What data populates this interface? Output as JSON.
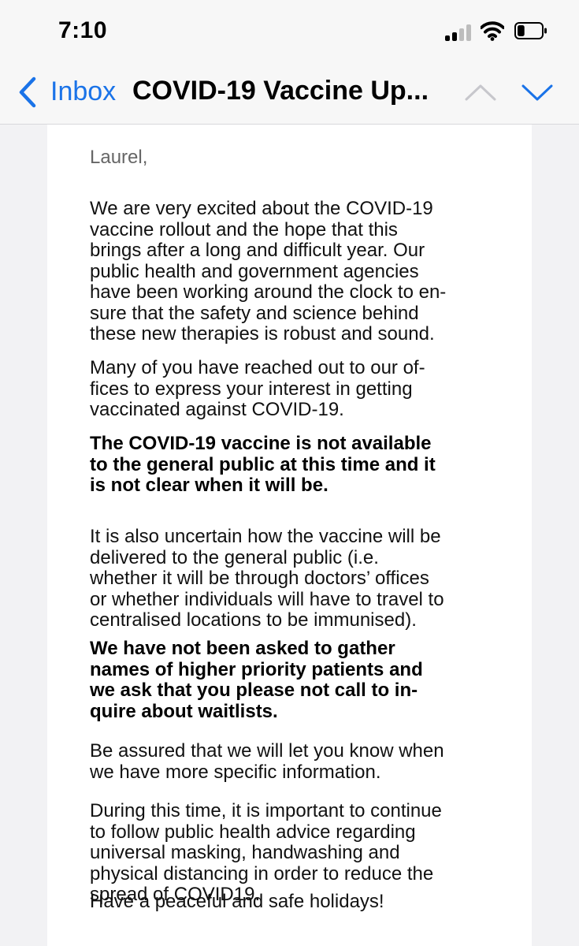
{
  "status_bar": {
    "time": "7:10",
    "signal_bars_active": 2,
    "battery_level": 0.3
  },
  "nav": {
    "back_label": "Inbox",
    "title": "COVID-19 Vaccine Up..."
  },
  "email": {
    "salutation": "Laurel,",
    "paragraphs": [
      {
        "bold": false,
        "lines": [
          "We are very excited about the COVID-19",
          "vaccine rollout and the hope that this",
          "brings after a long and difficult year.  Our",
          "public health and government agencies",
          "have been working around the clock to en-",
          "sure that the safety and science behind",
          "these new therapies is robust and sound."
        ]
      },
      {
        "bold": false,
        "lines": [
          "Many of you have reached out to our of-",
          "fices to express your interest in getting",
          "vaccinated against COVID-19."
        ]
      },
      {
        "bold": true,
        "lines": [
          "The COVID-19 vaccine is not available",
          "to the general public at this time and it",
          "is not clear when it will be."
        ]
      },
      {
        "bold": false,
        "lines": [
          "It is also uncertain how the vaccine will be",
          "delivered to the general public (i.e.",
          "whether it will be through doctors’ offices",
          "or whether individuals will have to travel to",
          "centralised locations to be immunised)."
        ]
      },
      {
        "bold": true,
        "lines": [
          "We have not been asked to gather",
          "names of higher priority patients and",
          "we ask that you please not call to in-",
          "quire about waitlists."
        ]
      },
      {
        "bold": false,
        "lines": [
          "Be assured that we will let you know when",
          "we have more specific information."
        ]
      },
      {
        "bold": false,
        "lines": [
          "During this time, it is important to continue",
          "to follow public health advice regarding",
          "universal masking, handwashing and",
          "physical distancing in order to reduce the",
          "spread of COVID19."
        ]
      },
      {
        "bold": false,
        "lines": [
          "Have a peaceful and safe holidays!"
        ]
      }
    ]
  },
  "colors": {
    "accent": "#1a73e8",
    "bars_chrome": "#f7f7f7",
    "page_background": "#f2f2f4"
  },
  "icons": [
    "cellular-signal-icon",
    "wifi-icon",
    "battery-icon",
    "chevron-left-icon",
    "chevron-up-icon",
    "chevron-down-icon"
  ]
}
